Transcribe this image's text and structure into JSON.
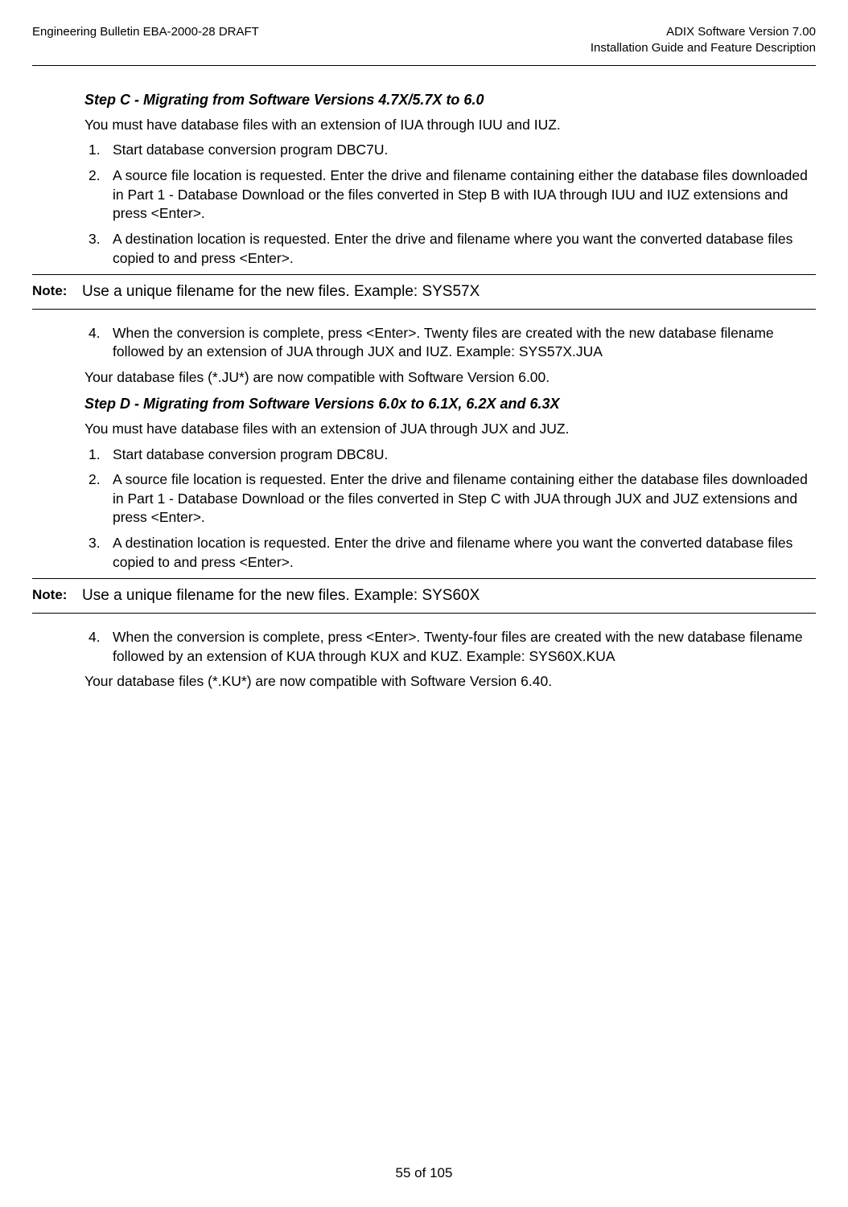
{
  "header": {
    "left": "Engineering Bulletin EBA-2000-28 DRAFT",
    "right_line1": "ADIX Software Version 7.00",
    "right_line2": "Installation Guide and Feature Description"
  },
  "stepC": {
    "heading": "Step C - Migrating from Software Versions 4.7X/5.7X to 6.0",
    "intro": "You must have database files with an extension of IUA through IUU and IUZ.",
    "items": [
      "Start database conversion program DBC7U.",
      "A source file location is requested. Enter the drive and filename containing either the database files downloaded in Part 1 - Database Download or the files converted in Step B with IUA through IUU and IUZ extensions and press <Enter>.",
      "A destination location is requested. Enter the drive and filename where you want the converted database files copied to and press <Enter>."
    ],
    "noteLabel": "Note:",
    "note": "Use a unique filename for the new files. Example: SYS57X",
    "items2": [
      "When the conversion is complete, press <Enter>. Twenty files are created with the new database filename followed by an extension of JUA through JUX and IUZ. Example: SYS57X.JUA"
    ],
    "outro": "Your database files (*.JU*) are now compatible with Software Version 6.00."
  },
  "stepD": {
    "heading": " Step D - Migrating from Software Versions 6.0x to 6.1X, 6.2X and 6.3X",
    "intro": "You must have database files with an extension of JUA through JUX and JUZ.",
    "items": [
      "Start database conversion program DBC8U.",
      "A source file location is requested. Enter the drive and filename containing either the database files downloaded in Part 1 - Database Download or the files converted in Step C with JUA through JUX and JUZ extensions and press <Enter>.",
      "A destination location is requested. Enter the drive and filename where you want the converted database files copied to and press <Enter>."
    ],
    "noteLabel": "Note:",
    "note": "Use a unique filename for the new files. Example: SYS60X",
    "items2": [
      "When the conversion is complete, press <Enter>.  Twenty-four files are created with the new database filename followed by an extension of KUA through KUX and KUZ. Example: SYS60X.KUA"
    ],
    "outro": "Your database files (*.KU*) are now compatible with Software Version 6.40."
  },
  "footer": "55 of 105"
}
